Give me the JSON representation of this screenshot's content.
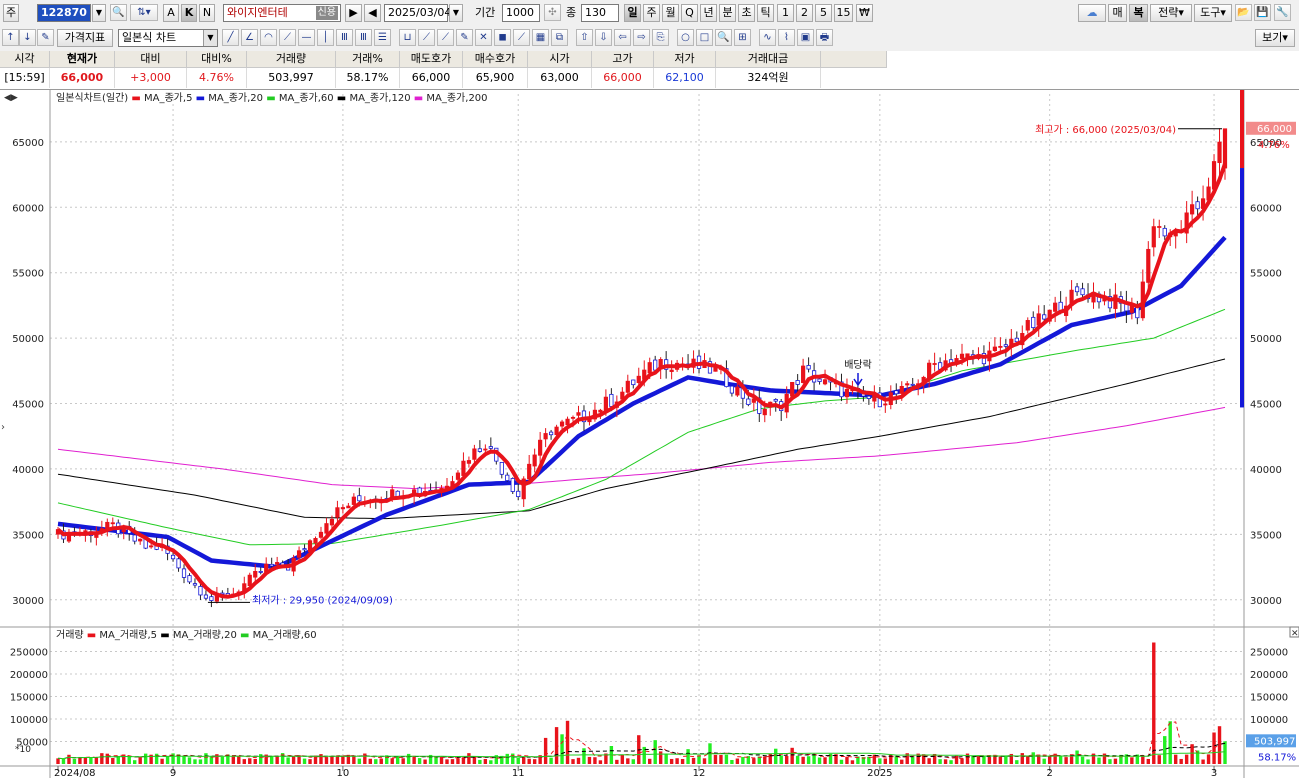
{
  "toolbar1": {
    "market_label": "주",
    "code": "122870",
    "stock_name": "와이지엔터테",
    "credit_badge": "신용",
    "date": "2025/03/04",
    "period_label": "기간",
    "period_value": "1000",
    "count_label": "종",
    "count_value": "130",
    "btn_a": "A",
    "btn_k": "K",
    "btn_n": "N",
    "periods": [
      "일",
      "주",
      "월",
      "Q",
      "년",
      "분",
      "초",
      "틱",
      "1",
      "2",
      "5",
      "15",
      "₩"
    ],
    "right_buttons": [
      "매",
      "복",
      "전략",
      "도구"
    ]
  },
  "toolbar2": {
    "price_index": "가격지표",
    "chart_type": "일본식 차트",
    "view_button": "보기"
  },
  "quote": {
    "headers": [
      "시각",
      "현재가",
      "대비",
      "대비%",
      "거래량",
      "거래%",
      "매도호가",
      "매수호가",
      "시가",
      "고가",
      "저가",
      "거래대금"
    ],
    "values": [
      "[15:59]",
      "66,000",
      "+3,000",
      "4.76%",
      "503,997",
      "58.17%",
      "66,000",
      "65,900",
      "63,000",
      "66,000",
      "62,100",
      "324억원"
    ]
  },
  "price_panel": {
    "legend_title": "일본식차트(일간)",
    "legend": [
      {
        "name": "MA_종가,5",
        "color": "#e8131b"
      },
      {
        "name": "MA_종가,20",
        "color": "#1418d8"
      },
      {
        "name": "MA_종가,60",
        "color": "#22cc22"
      },
      {
        "name": "MA_종가,120",
        "color": "#000000"
      },
      {
        "name": "MA_종가,200",
        "color": "#e020d0"
      }
    ],
    "high_annotation": "최고가 : 66,000 (2025/03/04)",
    "low_annotation": "최저가 : 29,950 (2024/09/09)",
    "dividend_label": "배당락",
    "last_price_tag": "66,000",
    "last_change_tag": "4.76%"
  },
  "volume_panel": {
    "legend_title": "거래량",
    "legend": [
      {
        "name": "MA_거래량,5",
        "color": "#e8131b"
      },
      {
        "name": "MA_거래량,20",
        "color": "#000000"
      },
      {
        "name": "MA_거래량,60",
        "color": "#22cc22"
      }
    ],
    "scale_note": "*10",
    "last_volume_tag": "503,997",
    "last_ratio_tag": "58.17%"
  },
  "chart_data": [
    {
      "type": "candlestick",
      "title": "일본식차트(일간)",
      "y_ticks": [
        30000,
        35000,
        40000,
        45000,
        50000,
        55000,
        60000,
        65000
      ],
      "y_tick_labels": [
        "30000",
        "35000",
        "40000",
        "45000",
        "50000",
        "55000",
        "60000",
        "65000"
      ],
      "ylim": [
        28300,
        68200
      ],
      "x_ticks": [
        "2024/08",
        "9",
        "10",
        "11",
        "12",
        "2025",
        "2",
        "3"
      ],
      "x_tick_index": [
        0,
        21,
        52,
        84,
        117,
        150,
        181,
        211
      ],
      "n": 214,
      "close_anchors": [
        [
          0,
          35000
        ],
        [
          6,
          35200
        ],
        [
          10,
          35600
        ],
        [
          16,
          34000
        ],
        [
          19,
          34000
        ],
        [
          24,
          31500
        ],
        [
          28,
          30000
        ],
        [
          32,
          30500
        ],
        [
          38,
          32500
        ],
        [
          42,
          32500
        ],
        [
          46,
          34500
        ],
        [
          50,
          36500
        ],
        [
          54,
          37500
        ],
        [
          62,
          38200
        ],
        [
          70,
          38500
        ],
        [
          75,
          41000
        ],
        [
          78,
          42000
        ],
        [
          84,
          38000
        ],
        [
          86,
          40500
        ],
        [
          90,
          43000
        ],
        [
          96,
          44000
        ],
        [
          102,
          45500
        ],
        [
          106,
          47000
        ],
        [
          110,
          48200
        ],
        [
          115,
          48000
        ],
        [
          120,
          47500
        ],
        [
          124,
          46000
        ],
        [
          128,
          44500
        ],
        [
          132,
          45000
        ],
        [
          136,
          47500
        ],
        [
          140,
          46500
        ],
        [
          146,
          45500
        ],
        [
          150,
          45300
        ],
        [
          155,
          46000
        ],
        [
          160,
          48000
        ],
        [
          164,
          48500
        ],
        [
          168,
          48500
        ],
        [
          172,
          49000
        ],
        [
          176,
          50500
        ],
        [
          180,
          51500
        ],
        [
          184,
          53000
        ],
        [
          188,
          53500
        ],
        [
          190,
          53200
        ],
        [
          194,
          52500
        ],
        [
          197,
          52000
        ],
        [
          200,
          59000
        ],
        [
          203,
          57500
        ],
        [
          206,
          59000
        ],
        [
          208,
          60000
        ],
        [
          211,
          63000
        ],
        [
          213,
          66000
        ]
      ],
      "high": 66000,
      "high_date": "2025/03/04",
      "low": 29950,
      "low_date": "2024/09/09",
      "moving_averages": [
        {
          "name": "MA_종가,20",
          "values": [
            [
              0,
              35800
            ],
            [
              20,
              34800
            ],
            [
              28,
              33000
            ],
            [
              40,
              32500
            ],
            [
              50,
              34500
            ],
            [
              60,
              36500
            ],
            [
              75,
              38800
            ],
            [
              86,
              39000
            ],
            [
              95,
              42500
            ],
            [
              105,
              45000
            ],
            [
              115,
              47000
            ],
            [
              122,
              46500
            ],
            [
              130,
              46000
            ],
            [
              140,
              45800
            ],
            [
              150,
              45600
            ],
            [
              160,
              46500
            ],
            [
              172,
              48000
            ],
            [
              185,
              51000
            ],
            [
              196,
              52000
            ],
            [
              205,
              54000
            ],
            [
              213,
              57700
            ]
          ]
        },
        {
          "name": "MA_종가,60",
          "values": [
            [
              0,
              37400
            ],
            [
              20,
              35500
            ],
            [
              35,
              34200
            ],
            [
              50,
              34300
            ],
            [
              70,
              35700
            ],
            [
              86,
              36900
            ],
            [
              100,
              39200
            ],
            [
              115,
              42800
            ],
            [
              128,
              44600
            ],
            [
              140,
              45200
            ],
            [
              150,
              45500
            ],
            [
              165,
              47500
            ],
            [
              185,
              49000
            ],
            [
              200,
              50000
            ],
            [
              213,
              52200
            ]
          ]
        },
        {
          "name": "MA_종가,120",
          "values": [
            [
              0,
              39600
            ],
            [
              25,
              38000
            ],
            [
              45,
              36300
            ],
            [
              60,
              36200
            ],
            [
              86,
              36800
            ],
            [
              100,
              38500
            ],
            [
              118,
              40000
            ],
            [
              135,
              41500
            ],
            [
              150,
              42500
            ],
            [
              170,
              44000
            ],
            [
              195,
              46500
            ],
            [
              213,
              48400
            ]
          ]
        },
        {
          "name": "MA_종가,200",
          "values": [
            [
              0,
              41500
            ],
            [
              30,
              40000
            ],
            [
              50,
              38800
            ],
            [
              65,
              38500
            ],
            [
              86,
              38900
            ],
            [
              110,
              39700
            ],
            [
              130,
              40500
            ],
            [
              150,
              41000
            ],
            [
              175,
              42000
            ],
            [
              195,
              43300
            ],
            [
              213,
              44700
            ]
          ]
        }
      ]
    },
    {
      "type": "bar",
      "title": "거래량",
      "y_ticks": [
        50000,
        100000,
        150000,
        200000,
        250000
      ],
      "y_tick_labels": [
        "50000",
        "100000",
        "150000",
        "200000",
        "250000"
      ],
      "ylim": [
        0,
        280000
      ],
      "n": 214,
      "base_volume": 18000,
      "spikes": [
        [
          27,
          24000
        ],
        [
          48,
          22000
        ],
        [
          89,
          58000
        ],
        [
          91,
          82000
        ],
        [
          93,
          96000
        ],
        [
          96,
          35000
        ],
        [
          106,
          64000
        ],
        [
          109,
          53000
        ],
        [
          110,
          28000
        ],
        [
          119,
          46000
        ],
        [
          131,
          34000
        ],
        [
          134,
          36000
        ],
        [
          178,
          26000
        ],
        [
          186,
          30000
        ],
        [
          200,
          270000
        ],
        [
          202,
          62000
        ],
        [
          207,
          44000
        ],
        [
          211,
          70000
        ],
        [
          212,
          84000
        ],
        [
          213,
          50400
        ]
      ],
      "green_spikes": [
        [
          92,
          66000
        ],
        [
          101,
          40000
        ],
        [
          107,
          38000
        ],
        [
          115,
          33000
        ],
        [
          203,
          95000
        ],
        [
          208,
          30000
        ],
        [
          213,
          50400
        ]
      ]
    }
  ]
}
